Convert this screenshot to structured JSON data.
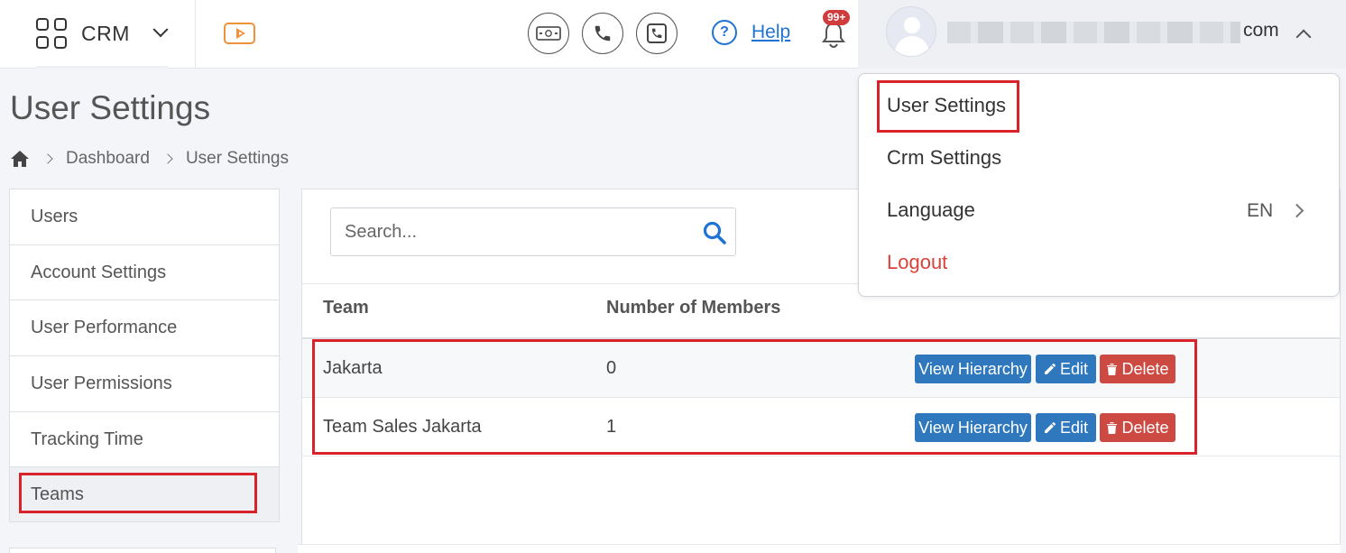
{
  "app": {
    "name": "CRM"
  },
  "header": {
    "help_label": "Help",
    "notification_count": "99+",
    "user_email_suffix": "com"
  },
  "page": {
    "title": "User Settings",
    "breadcrumb": [
      "Dashboard",
      "User Settings"
    ]
  },
  "sidebar": {
    "items": [
      {
        "label": "Users"
      },
      {
        "label": "Account Settings"
      },
      {
        "label": "User Performance"
      },
      {
        "label": "User Permissions"
      },
      {
        "label": "Tracking Time"
      },
      {
        "label": "Teams",
        "active": true
      }
    ]
  },
  "search": {
    "placeholder": "Search..."
  },
  "table": {
    "columns": [
      "Team",
      "Number of Members"
    ],
    "rows": [
      {
        "team": "Jakarta",
        "members": "0"
      },
      {
        "team": "Team Sales Jakarta",
        "members": "1"
      }
    ],
    "actions": {
      "view": "View Hierarchy",
      "edit": "Edit",
      "delete": "Delete"
    }
  },
  "dropdown": {
    "items": [
      "User Settings",
      "Crm Settings",
      "Language",
      "Logout"
    ],
    "language_value": "EN"
  },
  "colors": {
    "accent_blue": "#2f78bd",
    "danger_red": "#cd4a43",
    "highlight_red": "#d9232b",
    "video_orange": "#f0923a"
  }
}
